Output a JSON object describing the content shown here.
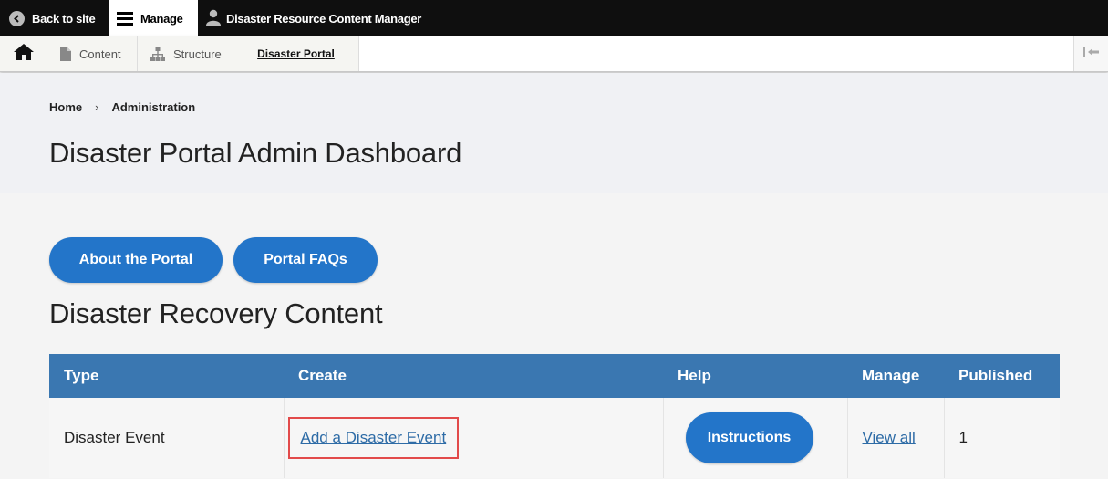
{
  "toolbar": {
    "back_label": "Back to site",
    "manage_label": "Manage",
    "user_label": "Disaster Resource Content Manager"
  },
  "tray": {
    "tabs": [
      {
        "label": "Content",
        "icon": "file-icon"
      },
      {
        "label": "Structure",
        "icon": "sitemap-icon"
      },
      {
        "label": "Disaster Portal",
        "icon": ""
      }
    ]
  },
  "breadcrumb": {
    "items": [
      "Home",
      "Administration"
    ],
    "separator": "›"
  },
  "page": {
    "title": "Disaster Portal Admin Dashboard"
  },
  "buttons": {
    "about": "About the Portal",
    "faq": "Portal FAQs"
  },
  "section": {
    "title": "Disaster Recovery Content"
  },
  "table": {
    "headers": [
      "Type",
      "Create",
      "Help",
      "Manage",
      "Published"
    ],
    "rows": [
      {
        "type": "Disaster Event",
        "create": "Add a Disaster Event",
        "help": "Instructions",
        "manage": "View all",
        "published": "1"
      }
    ]
  },
  "colors": {
    "toolbar_bg": "#0f0f0f",
    "accent_button": "#2375c9",
    "table_header": "#3a77b1",
    "link": "#2d6ba6",
    "highlight_border": "#e24a4a"
  }
}
